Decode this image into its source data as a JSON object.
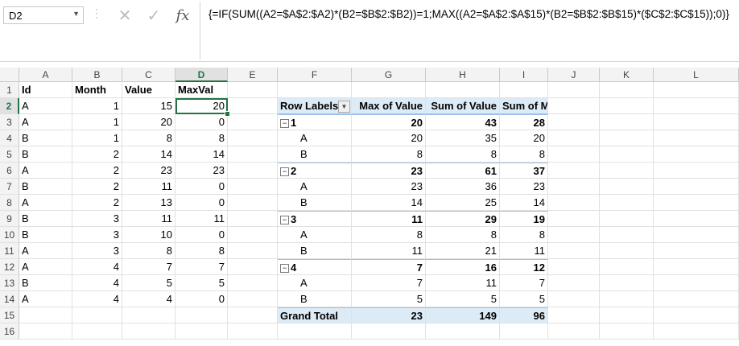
{
  "namebox": {
    "value": "D2"
  },
  "formula_bar": {
    "fx_label": "fx",
    "formula": "{=IF(SUM((A2=$A$2:$A2)*(B2=$B$2:$B2))=1;MAX((A2=$A$2:$A$15)*(B2=$B$2:$B$15)*($C$2:$C$15));0)}"
  },
  "columns": [
    "A",
    "B",
    "C",
    "D",
    "E",
    "F",
    "G",
    "H",
    "I",
    "J",
    "K",
    "L"
  ],
  "active_column": "D",
  "active_row": 2,
  "rows": [
    "1",
    "2",
    "3",
    "4",
    "5",
    "6",
    "7",
    "8",
    "9",
    "10",
    "11",
    "12",
    "13",
    "14",
    "15",
    "16"
  ],
  "table": {
    "headers": [
      "Id",
      "Month",
      "Value",
      "MaxVal"
    ],
    "data": [
      [
        "A",
        "1",
        "15",
        "20"
      ],
      [
        "A",
        "1",
        "20",
        "0"
      ],
      [
        "B",
        "1",
        "8",
        "8"
      ],
      [
        "B",
        "2",
        "14",
        "14"
      ],
      [
        "A",
        "2",
        "23",
        "23"
      ],
      [
        "B",
        "2",
        "11",
        "0"
      ],
      [
        "A",
        "2",
        "13",
        "0"
      ],
      [
        "B",
        "3",
        "11",
        "11"
      ],
      [
        "B",
        "3",
        "10",
        "0"
      ],
      [
        "A",
        "3",
        "8",
        "8"
      ],
      [
        "A",
        "4",
        "7",
        "7"
      ],
      [
        "B",
        "4",
        "5",
        "5"
      ],
      [
        "A",
        "4",
        "4",
        "0"
      ]
    ]
  },
  "pivot": {
    "headers": [
      "Row Labels",
      "Max of Value",
      "Sum of Value",
      "Sum of MaxVal"
    ],
    "rows": [
      {
        "label": "1",
        "group": true,
        "v": [
          "20",
          "43",
          "28"
        ]
      },
      {
        "label": "A",
        "group": false,
        "v": [
          "20",
          "35",
          "20"
        ]
      },
      {
        "label": "B",
        "group": false,
        "v": [
          "8",
          "8",
          "8"
        ]
      },
      {
        "label": "2",
        "group": true,
        "v": [
          "23",
          "61",
          "37"
        ]
      },
      {
        "label": "A",
        "group": false,
        "v": [
          "23",
          "36",
          "23"
        ]
      },
      {
        "label": "B",
        "group": false,
        "v": [
          "14",
          "25",
          "14"
        ]
      },
      {
        "label": "3",
        "group": true,
        "v": [
          "11",
          "29",
          "19"
        ]
      },
      {
        "label": "A",
        "group": false,
        "v": [
          "8",
          "8",
          "8"
        ]
      },
      {
        "label": "B",
        "group": false,
        "v": [
          "11",
          "21",
          "11"
        ]
      },
      {
        "label": "4",
        "group": true,
        "v": [
          "7",
          "16",
          "12"
        ]
      },
      {
        "label": "A",
        "group": false,
        "v": [
          "7",
          "11",
          "7"
        ]
      },
      {
        "label": "B",
        "group": false,
        "v": [
          "5",
          "5",
          "5"
        ]
      }
    ],
    "grand_total": {
      "label": "Grand Total",
      "v": [
        "23",
        "149",
        "96"
      ]
    }
  },
  "colors": {
    "accent": "#217346",
    "pivot_header": "#ddebf7",
    "pivot_border": "#9bc2e6"
  }
}
